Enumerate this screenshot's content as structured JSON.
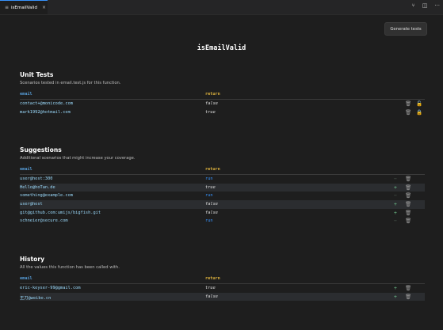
{
  "tab": {
    "label": "isEmailValid",
    "close": "×"
  },
  "toolbar": {
    "generate_label": "Generate tests"
  },
  "function_name": "isEmailValid",
  "unit_tests": {
    "title": "Unit Tests",
    "description": "Scenarios tested in email.test.js for this function.",
    "col_email": "email",
    "col_return": "return",
    "rows": [
      {
        "email": "contact+@monicode.com",
        "return": "false",
        "locked": false
      },
      {
        "email": "mark1992@hotmail.com",
        "return": "true",
        "locked": true
      }
    ]
  },
  "suggestions": {
    "title": "Suggestions",
    "description": "Additional scenarios that might increase your coverage.",
    "col_email": "email",
    "col_return": "return",
    "rows": [
      {
        "email": "user@host:300",
        "return": "run"
      },
      {
        "email": "Hello@hoTan.de",
        "return": "true"
      },
      {
        "email": "something@example.com",
        "return": "run"
      },
      {
        "email": "user@host",
        "return": "false"
      },
      {
        "email": "git@github.com:umijs/bigfish.git",
        "return": "false"
      },
      {
        "email": "schneier@secure.com",
        "return": "run"
      }
    ]
  },
  "history": {
    "title": "History",
    "description": "All the values this function has been called with.",
    "col_email": "email",
    "col_return": "return",
    "rows": [
      {
        "email": "eric-keyser-99@gmail.com",
        "return": "true"
      },
      {
        "email": "王刀@weibo.cn",
        "return": "false"
      }
    ]
  },
  "icons": {
    "tab": "file-icon",
    "actions": [
      "branch-compare-icon",
      "split-editor-icon",
      "more-icon"
    ],
    "row": [
      "add-icon",
      "trash-icon",
      "lock-icon"
    ]
  },
  "colors": {
    "accent": "#3794ff",
    "email": "#9cdcfe",
    "return_header": "#dcb13d",
    "add": "#73c991",
    "lock": "#d7a435"
  }
}
